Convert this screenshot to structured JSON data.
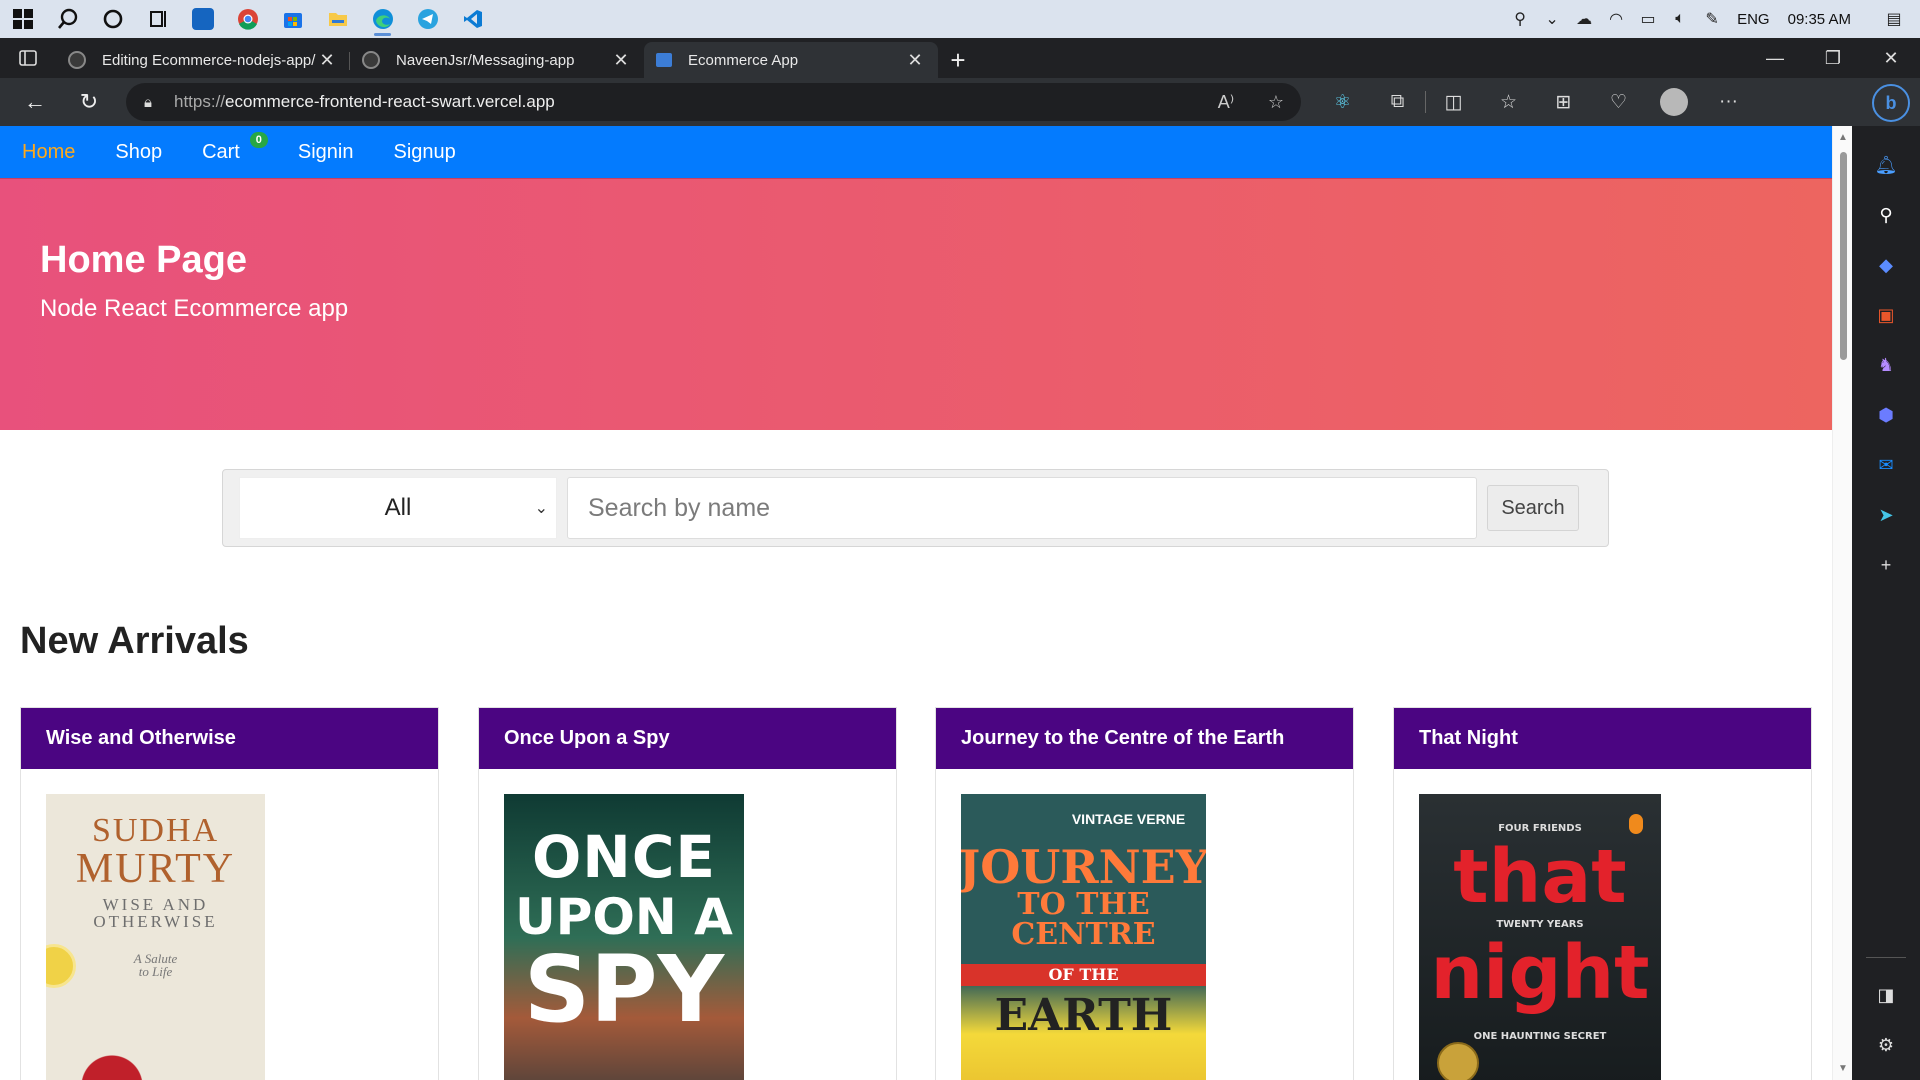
{
  "taskbar": {
    "tray_lang": "ENG",
    "tray_time": "09:35 AM",
    "apps": [
      "windows-start",
      "search",
      "cortana",
      "task-view",
      "outlook",
      "chrome",
      "microsoft-store",
      "file-explorer",
      "edge",
      "telegram",
      "vscode"
    ]
  },
  "browser": {
    "tabs": [
      {
        "title": "Editing Ecommerce-nodejs-app/",
        "close": "✕"
      },
      {
        "title": "NaveenJsr/Messaging-app",
        "close": "✕"
      },
      {
        "title": "Ecommerce App",
        "close": "✕"
      }
    ],
    "new_tab": "+",
    "url_prefix": "https://",
    "url_host": "ecommerce-frontend-react-swart.vercel.app"
  },
  "site": {
    "nav": {
      "home": "Home",
      "shop": "Shop",
      "cart": "Cart",
      "cart_count": "0",
      "signin": "Signin",
      "signup": "Signup"
    },
    "hero": {
      "title": "Home Page",
      "subtitle": "Node React Ecommerce app"
    },
    "search": {
      "category_selected": "All",
      "placeholder": "Search by name",
      "button": "Search"
    },
    "section_title": "New Arrivals",
    "products": [
      {
        "name": "Wise and Otherwise",
        "cover_lines": [
          "SUDHA",
          "MURTY",
          "WISE AND",
          "OTHERWISE",
          "A Salute",
          "to Life"
        ],
        "cover_bg": "#e9e4d6",
        "cover_fg": "#b0612d"
      },
      {
        "name": "Once Upon a Spy",
        "cover_lines": [
          "ONCE",
          "UPON A",
          "SPY"
        ],
        "cover_bg": "#1f4a3a",
        "cover_fg": "#ffffff"
      },
      {
        "name": "Journey to the Centre of the Earth",
        "cover_lines": [
          "VINTAGE VERNE",
          "JOURNEY",
          "TO THE CENTRE",
          "OF THE",
          "EARTH"
        ],
        "cover_bg": "#2b5a5a",
        "cover_fg": "#c9e6de"
      },
      {
        "name": "That Night",
        "cover_lines": [
          "FOUR FRIENDS",
          "that",
          "TWENTY YEARS",
          "night",
          "ONE HAUNTING SECRET"
        ],
        "cover_bg": "#1b2226",
        "cover_fg": "#e3222b"
      }
    ]
  },
  "colors": {
    "site_nav": "#047bfe",
    "nav_active": "#ffa91a",
    "hero_start": "#e8517c",
    "hero_end": "#ed6560",
    "card_header": "#4b0582",
    "cart_badge": "#28a745"
  }
}
